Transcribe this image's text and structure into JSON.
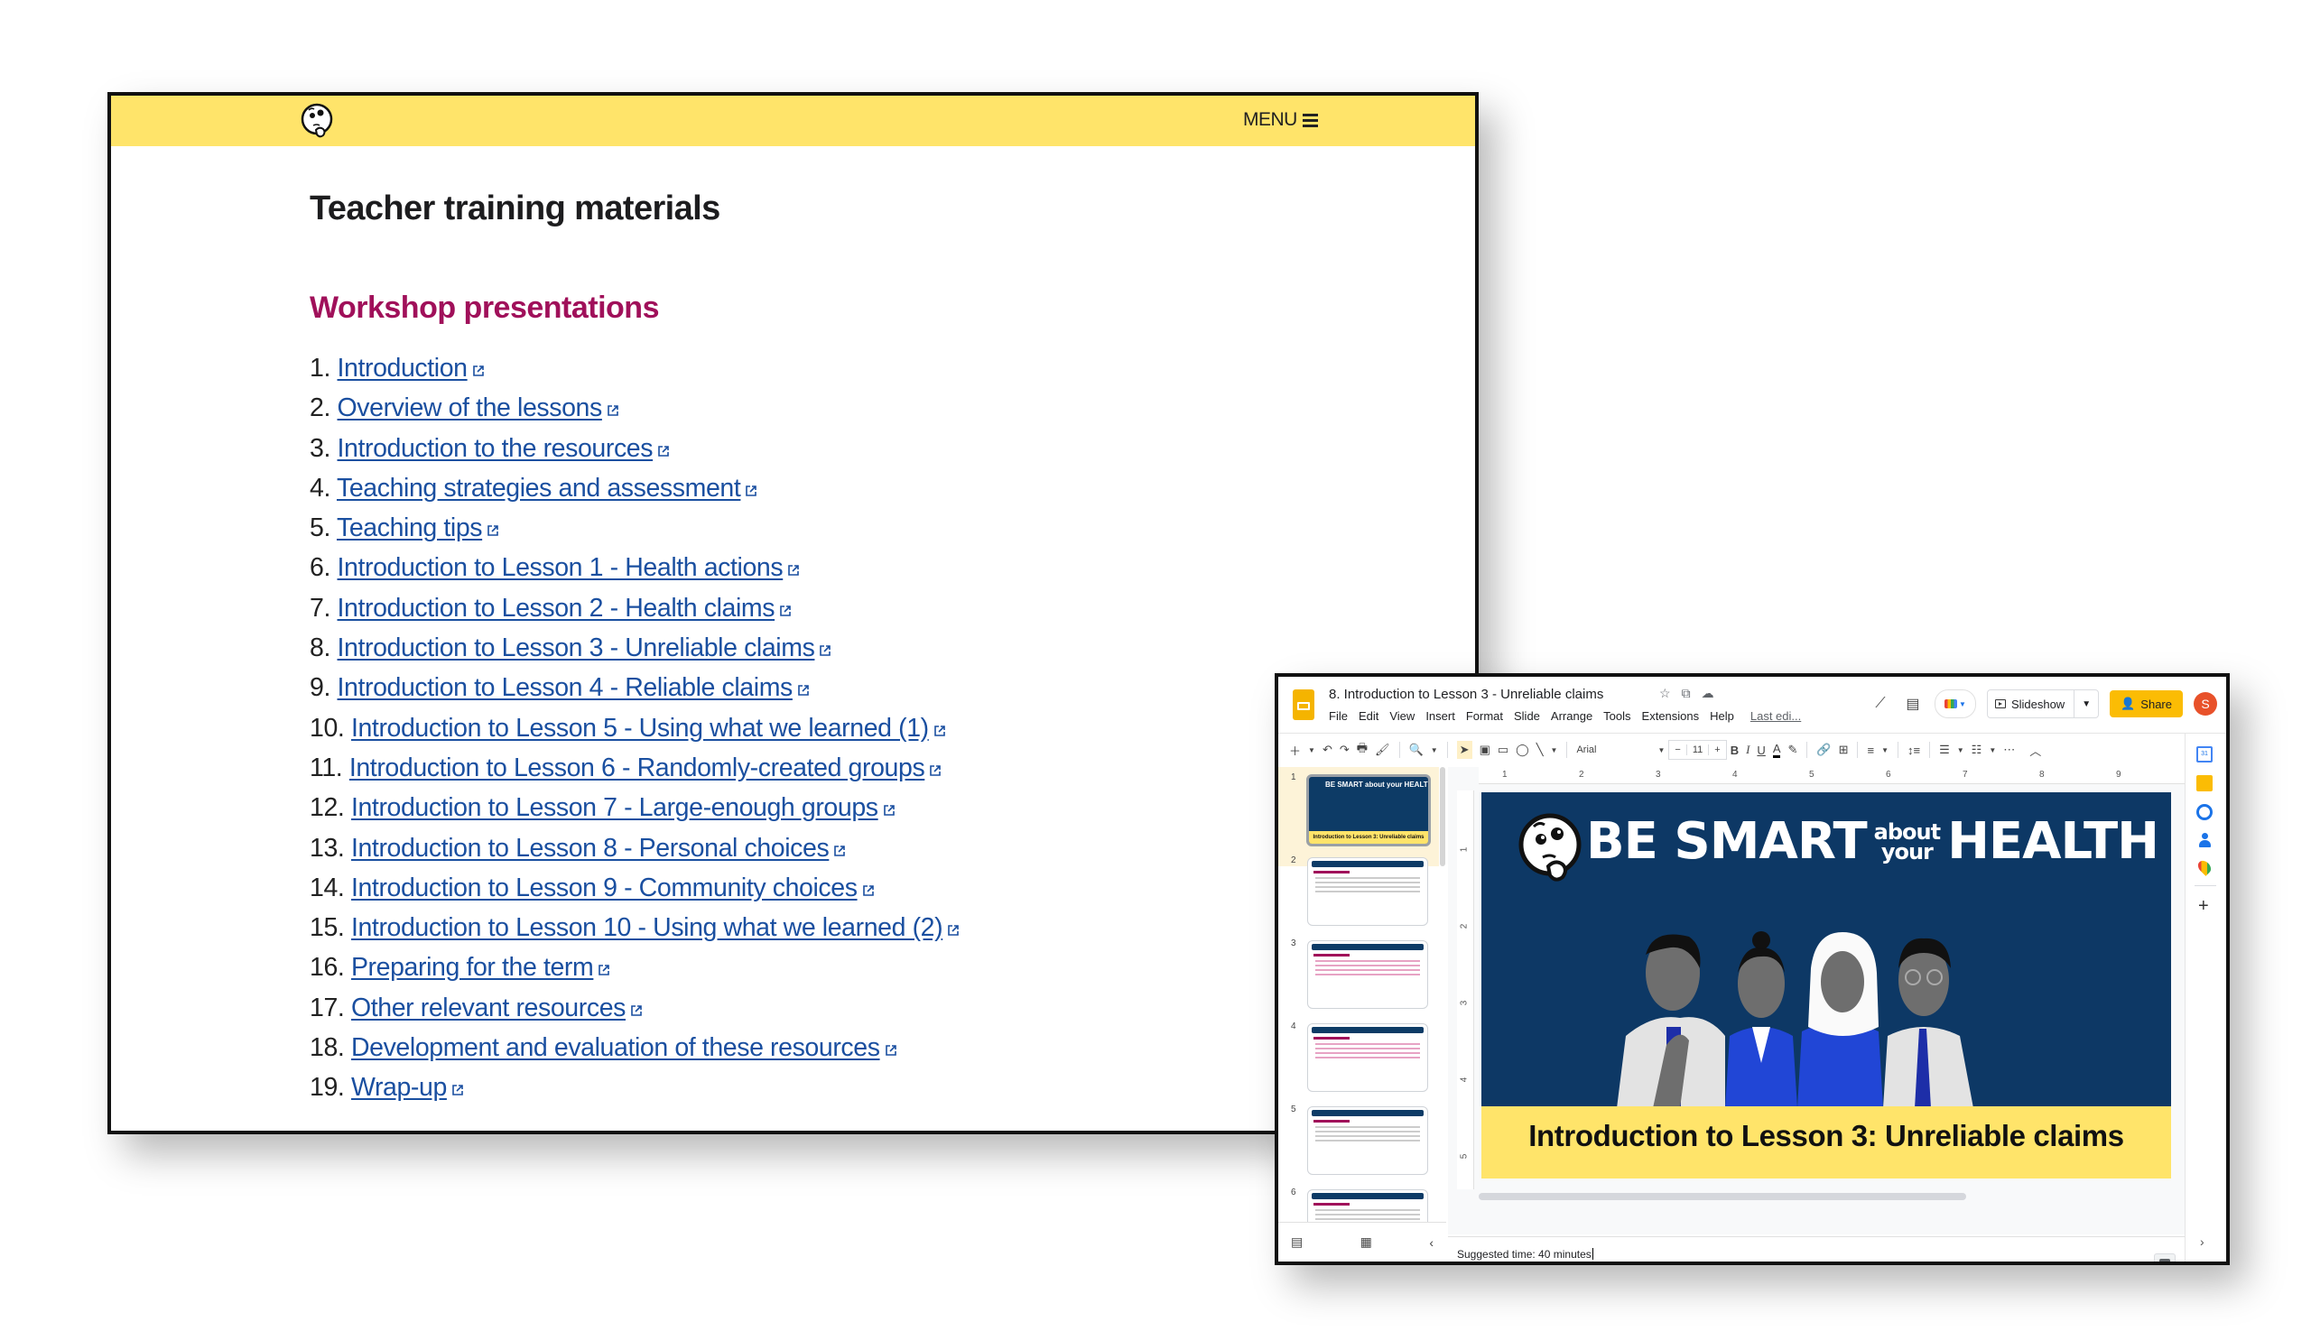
{
  "website": {
    "logo": "thinking-face-logo",
    "menu_label": "MENU",
    "menu_icon": "hamburger-icon",
    "title": "Teacher training materials",
    "section_title": "Workshop presentations",
    "accent_color": "#a0105a",
    "header_color": "#ffe46a",
    "link_color": "#1a4fa0",
    "items": [
      {
        "num": "1.",
        "label": "Introduction"
      },
      {
        "num": "2.",
        "label": "Overview of the lessons"
      },
      {
        "num": "3.",
        "label": "Introduction to the resources"
      },
      {
        "num": "4.",
        "label": "Teaching strategies and assessment"
      },
      {
        "num": "5.",
        "label": "Teaching tips"
      },
      {
        "num": "6.",
        "label": "Introduction to Lesson 1 - Health actions"
      },
      {
        "num": "7.",
        "label": "Introduction to Lesson 2 - Health claims"
      },
      {
        "num": "8.",
        "label": "Introduction to Lesson 3 - Unreliable claims"
      },
      {
        "num": "9.",
        "label": "Introduction to Lesson 4 - Reliable claims"
      },
      {
        "num": "10.",
        "label": "Introduction to Lesson 5 - Using what we learned (1)"
      },
      {
        "num": "11.",
        "label": "Introduction to Lesson 6 - Randomly-created groups"
      },
      {
        "num": "12.",
        "label": "Introduction to Lesson 7 - Large-enough groups"
      },
      {
        "num": "13.",
        "label": "Introduction to Lesson 8 - Personal choices"
      },
      {
        "num": "14.",
        "label": "Introduction to Lesson 9 - Community choices"
      },
      {
        "num": "15.",
        "label": "Introduction to Lesson 10 - Using what we learned (2)"
      },
      {
        "num": "16.",
        "label": "Preparing for the term"
      },
      {
        "num": "17.",
        "label": "Other relevant resources"
      },
      {
        "num": "18.",
        "label": "Development and evaluation of these resources"
      },
      {
        "num": "19.",
        "label": "Wrap-up"
      }
    ]
  },
  "slides_app": {
    "doc_title": "8. Introduction to Lesson 3 - Unreliable claims",
    "title_icons": [
      "star-icon",
      "move-to-folder-icon",
      "cloud-saved-icon"
    ],
    "menu": [
      "File",
      "Edit",
      "View",
      "Insert",
      "Format",
      "Slide",
      "Arrange",
      "Tools",
      "Extensions",
      "Help"
    ],
    "last_edit": "Last edi...",
    "slideshow_label": "Slideshow",
    "share_label": "Share",
    "avatar_initial": "S",
    "toolbar": {
      "font": "Arial",
      "font_size": "11",
      "minus": "−",
      "plus": "+"
    },
    "ruler_h": [
      "1",
      "2",
      "3",
      "4",
      "5",
      "6",
      "7",
      "8",
      "9"
    ],
    "ruler_v": [
      "1",
      "2",
      "3",
      "4",
      "5"
    ],
    "thumbnails": [
      {
        "num": "1",
        "title": "BE SMART about your HEALTH",
        "caption": "Introduction to Lesson 3: Unreliable claims"
      },
      {
        "num": "2",
        "title": "Learning goals"
      },
      {
        "num": "3",
        "title": "Underlying principles"
      },
      {
        "num": "4",
        "title": "Underlying principles"
      },
      {
        "num": "5",
        "title": "Key terms"
      },
      {
        "num": "6",
        "title": "Background"
      }
    ],
    "slide": {
      "brand_be_smart": "BE SMART",
      "brand_about": "about",
      "brand_your": "your",
      "brand_health": "HEALTH",
      "caption": "Introduction to Lesson 3: Unreliable claims",
      "bg_color": "#0d3865",
      "caption_color": "#ffe46a"
    },
    "speaker_notes": "Suggested time: 40 minutes",
    "side_panel": [
      "calendar-icon",
      "keep-icon",
      "tasks-icon",
      "contacts-icon",
      "maps-icon",
      "add-icon"
    ]
  }
}
